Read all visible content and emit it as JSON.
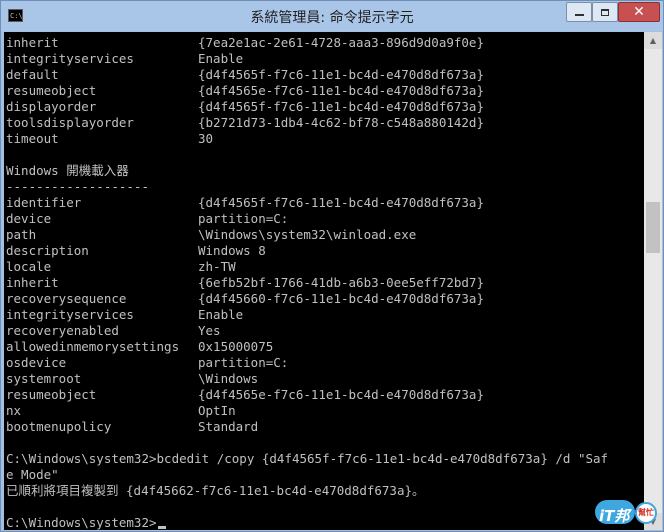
{
  "window": {
    "title": "系統管理員: 命令提示字元",
    "icon_label": "C:\\_"
  },
  "caption_buttons": {
    "minimize_icon": "minimize-icon",
    "maximize_icon": "maximize-icon",
    "close_icon": "close-icon",
    "close_glyph": "✕"
  },
  "colors": {
    "console_bg": "#000000",
    "console_text": "#c0c0c0",
    "titlebar": "#a9c6e8",
    "close_button": "#c75050"
  },
  "console": {
    "block1": [
      {
        "key": "inherit",
        "value": "{7ea2e1ac-2e61-4728-aaa3-896d9d0a9f0e}"
      },
      {
        "key": "integrityservices",
        "value": "Enable"
      },
      {
        "key": "default",
        "value": "{d4f4565f-f7c6-11e1-bc4d-e470d8df673a}"
      },
      {
        "key": "resumeobject",
        "value": "{d4f4565e-f7c6-11e1-bc4d-e470d8df673a}"
      },
      {
        "key": "displayorder",
        "value": "{d4f4565f-f7c6-11e1-bc4d-e470d8df673a}"
      },
      {
        "key": "toolsdisplayorder",
        "value": "{b2721d73-1db4-4c62-bf78-c548a880142d}"
      },
      {
        "key": "timeout",
        "value": "30"
      }
    ],
    "section_title": "Windows 開機載入器",
    "section_rule": "-------------------",
    "block2": [
      {
        "key": "identifier",
        "value": "{d4f4565f-f7c6-11e1-bc4d-e470d8df673a}"
      },
      {
        "key": "device",
        "value": "partition=C:"
      },
      {
        "key": "path",
        "value": "\\Windows\\system32\\winload.exe"
      },
      {
        "key": "description",
        "value": "Windows 8"
      },
      {
        "key": "locale",
        "value": "zh-TW"
      },
      {
        "key": "inherit",
        "value": "{6efb52bf-1766-41db-a6b3-0ee5eff72bd7}"
      },
      {
        "key": "recoverysequence",
        "value": "{d4f45660-f7c6-11e1-bc4d-e470d8df673a}"
      },
      {
        "key": "integrityservices",
        "value": "Enable"
      },
      {
        "key": "recoveryenabled",
        "value": "Yes"
      },
      {
        "key": "allowedinmemorysettings",
        "value": "0x15000075"
      },
      {
        "key": "osdevice",
        "value": "partition=C:"
      },
      {
        "key": "systemroot",
        "value": "\\Windows"
      },
      {
        "key": "resumeobject",
        "value": "{d4f4565e-f7c6-11e1-bc4d-e470d8df673a}"
      },
      {
        "key": "nx",
        "value": "OptIn"
      },
      {
        "key": "bootmenupolicy",
        "value": "Standard"
      }
    ],
    "command_line1": "C:\\Windows\\system32>bcdedit /copy {d4f4565f-f7c6-11e1-bc4d-e470d8df673a} /d \"Saf",
    "command_line2": "e Mode\"",
    "result_line": "已順利將項目複製到 {d4f45662-f7c6-11e1-bc4d-e470d8df673a}。",
    "prompt_line": "C:\\Windows\\system32>"
  },
  "scrollbar": {
    "up_icon": "scroll-up-arrow-icon",
    "down_icon": "scroll-down-arrow-icon",
    "up_glyph": "▲",
    "down_glyph": "▼",
    "thumb_position": 0.33,
    "thumb_size": 0.11
  },
  "watermark": {
    "brand": "iT邦",
    "sub": "幫忙"
  }
}
